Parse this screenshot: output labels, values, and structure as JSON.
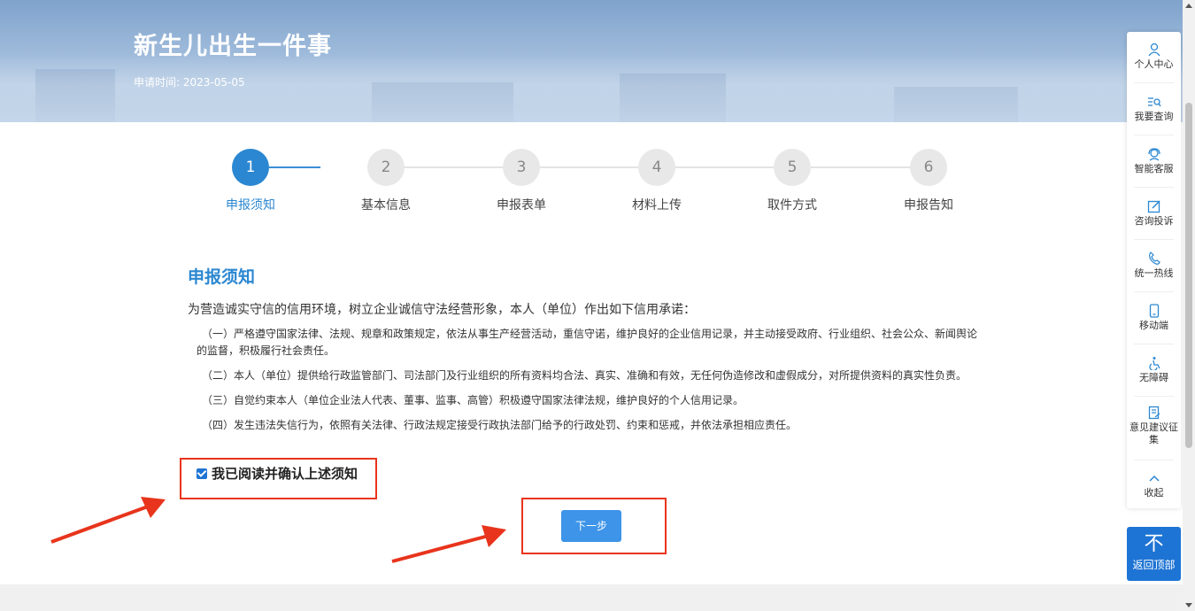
{
  "banner": {
    "title": "新生儿出生一件事",
    "date_label": "申请时间: 2023-05-05"
  },
  "steps": [
    {
      "number": "1",
      "label": "申报须知",
      "active": true
    },
    {
      "number": "2",
      "label": "基本信息",
      "active": false
    },
    {
      "number": "3",
      "label": "申报表单",
      "active": false
    },
    {
      "number": "4",
      "label": "材料上传",
      "active": false
    },
    {
      "number": "5",
      "label": "取件方式",
      "active": false
    },
    {
      "number": "6",
      "label": "申报告知",
      "active": false
    }
  ],
  "notice": {
    "title": "申报须知",
    "intro": "为营造诚实守信的信用环境，树立企业诚信守法经营形象，本人（单位）作出如下信用承诺：",
    "items": [
      "（一）严格遵守国家法律、法规、规章和政策规定，依法从事生产经营活动，重信守诺，维护良好的企业信用记录，并主动接受政府、行业组织、社会公众、新闻舆论的监督，积极履行社会责任。",
      "（二）本人（单位）提供给行政监管部门、司法部门及行业组织的所有资料均合法、真实、准确和有效，无任何伪造修改和虚假成分，对所提供资料的真实性负责。",
      "（三）自觉约束本人（单位企业法人代表、董事、监事、高管）积极遵守国家法律法规，维护良好的个人信用记录。",
      "（四）发生违法失信行为，依照有关法律、行政法规定接受行政执法部门给予的行政处罚、约束和惩戒，并依法承担相应责任。"
    ]
  },
  "agree": {
    "label": "我已阅读并确认上述须知",
    "checked": true
  },
  "next_button": "下一步",
  "sidebar": {
    "items": [
      {
        "label": "个人中心",
        "icon": "person-icon"
      },
      {
        "label": "我要查询",
        "icon": "search-list-icon"
      },
      {
        "label": "智能客服",
        "icon": "service-icon"
      },
      {
        "label": "咨询投诉",
        "icon": "edit-icon"
      },
      {
        "label": "统一热线",
        "icon": "phone-icon"
      },
      {
        "label": "移动端",
        "icon": "mobile-icon"
      },
      {
        "label": "无障碍",
        "icon": "accessibility-icon"
      },
      {
        "label": "意见建议征集",
        "icon": "feedback-icon"
      },
      {
        "label": "收起",
        "icon": "chevron-up-icon"
      }
    ]
  },
  "back_top": {
    "icon": "不",
    "label": "返回顶部"
  },
  "colors": {
    "primary": "#2b87d1",
    "button": "#3d94e8",
    "annotation_red": "#e8341c"
  }
}
